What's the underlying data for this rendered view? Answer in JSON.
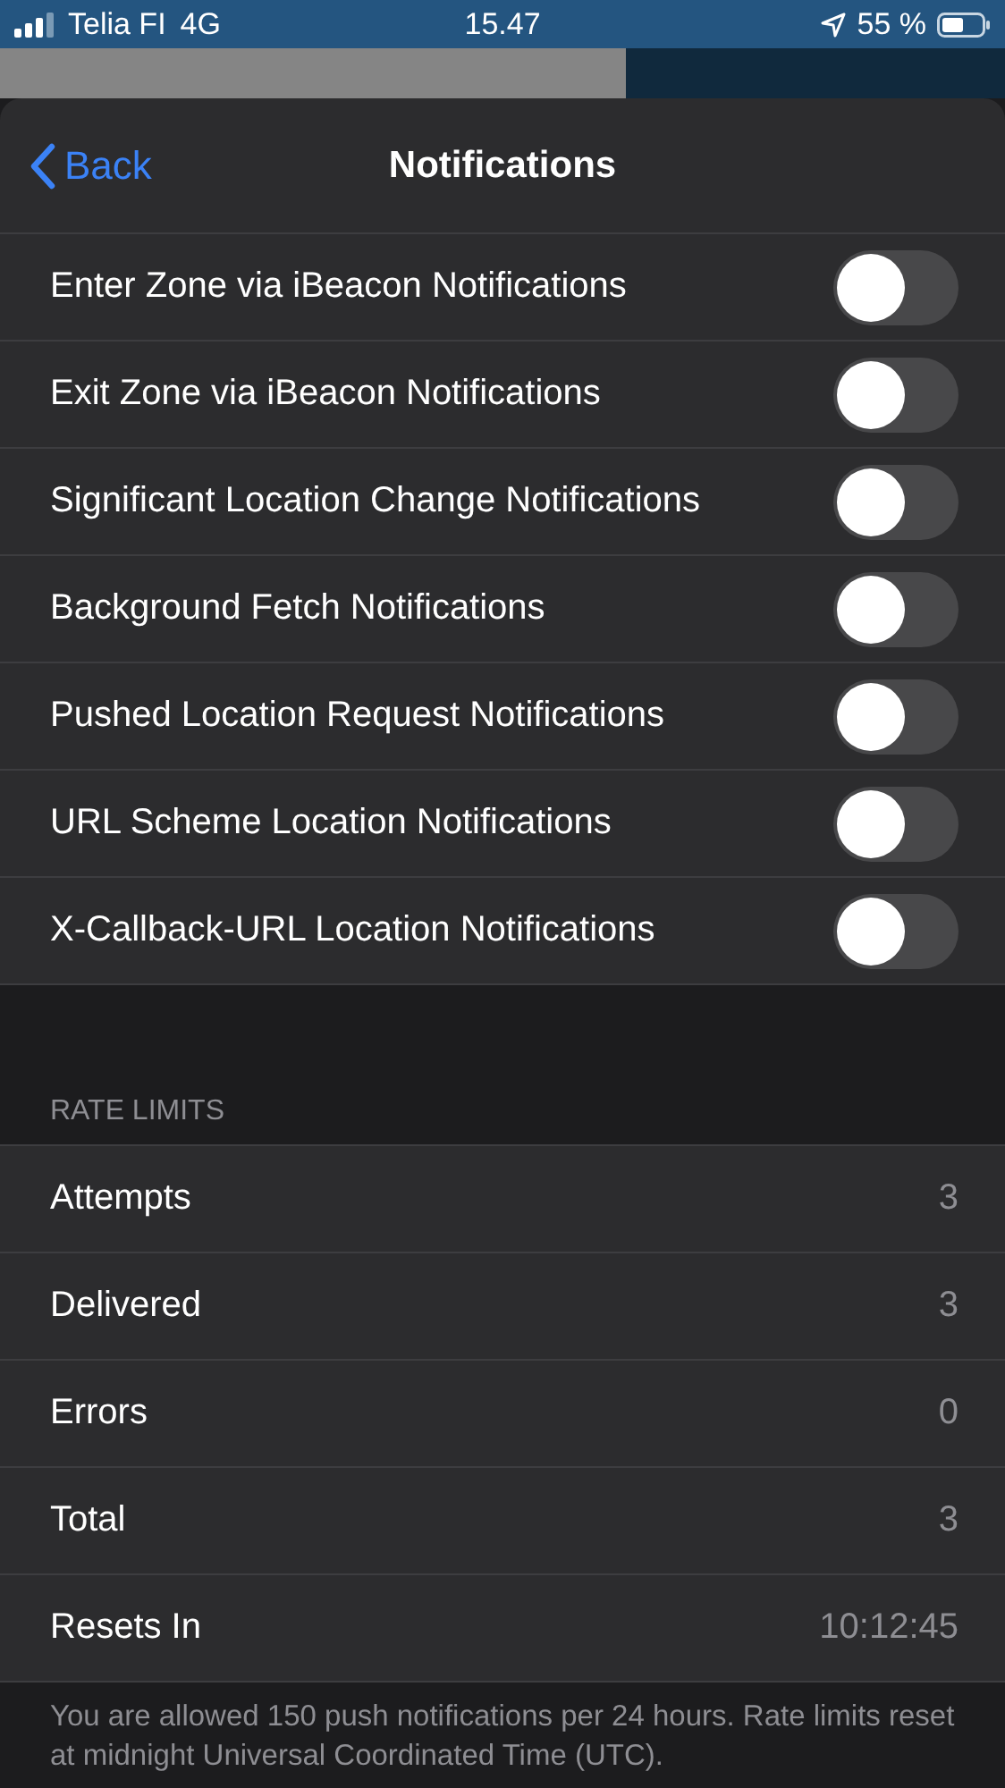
{
  "status_bar": {
    "carrier": "Telia FI",
    "network": "4G",
    "time": "15.47",
    "battery": "55 %"
  },
  "nav": {
    "back": "Back",
    "title": "Notifications"
  },
  "toggles": [
    {
      "label": "Enter Zone via iBeacon Notifications",
      "on": false
    },
    {
      "label": "Exit Zone via iBeacon Notifications",
      "on": false
    },
    {
      "label": "Significant Location Change Notifications",
      "on": false
    },
    {
      "label": "Background Fetch Notifications",
      "on": false
    },
    {
      "label": "Pushed Location Request Notifications",
      "on": false
    },
    {
      "label": "URL Scheme Location Notifications",
      "on": false
    },
    {
      "label": "X-Callback-URL Location Notifications",
      "on": false
    }
  ],
  "rate_limits": {
    "header": "RATE LIMITS",
    "rows": [
      {
        "label": "Attempts",
        "value": "3"
      },
      {
        "label": "Delivered",
        "value": "3"
      },
      {
        "label": "Errors",
        "value": "0"
      },
      {
        "label": "Total",
        "value": "3"
      },
      {
        "label": "Resets In",
        "value": "10:12:45"
      }
    ],
    "footer": "You are allowed 150 push notifications per 24 hours. Rate limits reset at midnight Universal Coordinated Time (UTC)."
  }
}
